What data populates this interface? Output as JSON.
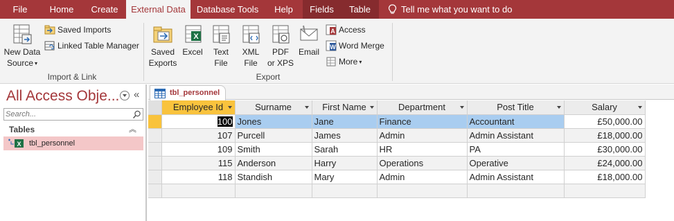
{
  "menu": {
    "tabs": [
      {
        "label": "File",
        "active": false
      },
      {
        "label": "Home",
        "active": false
      },
      {
        "label": "Create",
        "active": false
      },
      {
        "label": "External Data",
        "active": true
      },
      {
        "label": "Database Tools",
        "active": false
      },
      {
        "label": "Help",
        "active": false
      },
      {
        "label": "Fields",
        "active": false,
        "contextual": true
      },
      {
        "label": "Table",
        "active": false,
        "contextual": true
      }
    ],
    "tell_me": "Tell me what you want to do"
  },
  "ribbon": {
    "import_link": {
      "new_data_source_line1": "New Data",
      "new_data_source_line2": "Source",
      "saved_imports": "Saved Imports",
      "linked_table_manager": "Linked Table Manager",
      "group_label": "Import & Link"
    },
    "export": {
      "saved_exports_line1": "Saved",
      "saved_exports_line2": "Exports",
      "excel": "Excel",
      "text_file_line1": "Text",
      "text_file_line2": "File",
      "xml_file_line1": "XML",
      "xml_file_line2": "File",
      "pdf_line1": "PDF",
      "pdf_line2": "or XPS",
      "email": "Email",
      "access": "Access",
      "word_merge": "Word Merge",
      "more": "More",
      "group_label": "Export"
    }
  },
  "nav": {
    "title": "All Access Obje...",
    "search_placeholder": "Search...",
    "group": "Tables",
    "items": [
      {
        "label": "tbl_personnel"
      }
    ]
  },
  "document": {
    "tab_label": "tbl_personnel",
    "columns": [
      "Employee Id",
      "Surname",
      "First Name",
      "Department",
      "Post Title",
      "Salary"
    ],
    "rows": [
      [
        "100",
        "Jones",
        "Jane",
        "Finance",
        "Accountant",
        "£50,000.00"
      ],
      [
        "107",
        "Purcell",
        "James",
        "Admin",
        "Admin Assistant",
        "£18,000.00"
      ],
      [
        "109",
        "Smith",
        "Sarah",
        "HR",
        "PA",
        "£30,000.00"
      ],
      [
        "115",
        "Anderson",
        "Harry",
        "Operations",
        "Operative",
        "£24,000.00"
      ],
      [
        "118",
        "Standish",
        "Mary",
        "Admin",
        "Admin Assistant",
        "£18,000.00"
      ]
    ]
  },
  "colors": {
    "accent": "#a4373a",
    "selection_highlight": "#f9c33d",
    "row_highlight": "#a9cdf0"
  }
}
